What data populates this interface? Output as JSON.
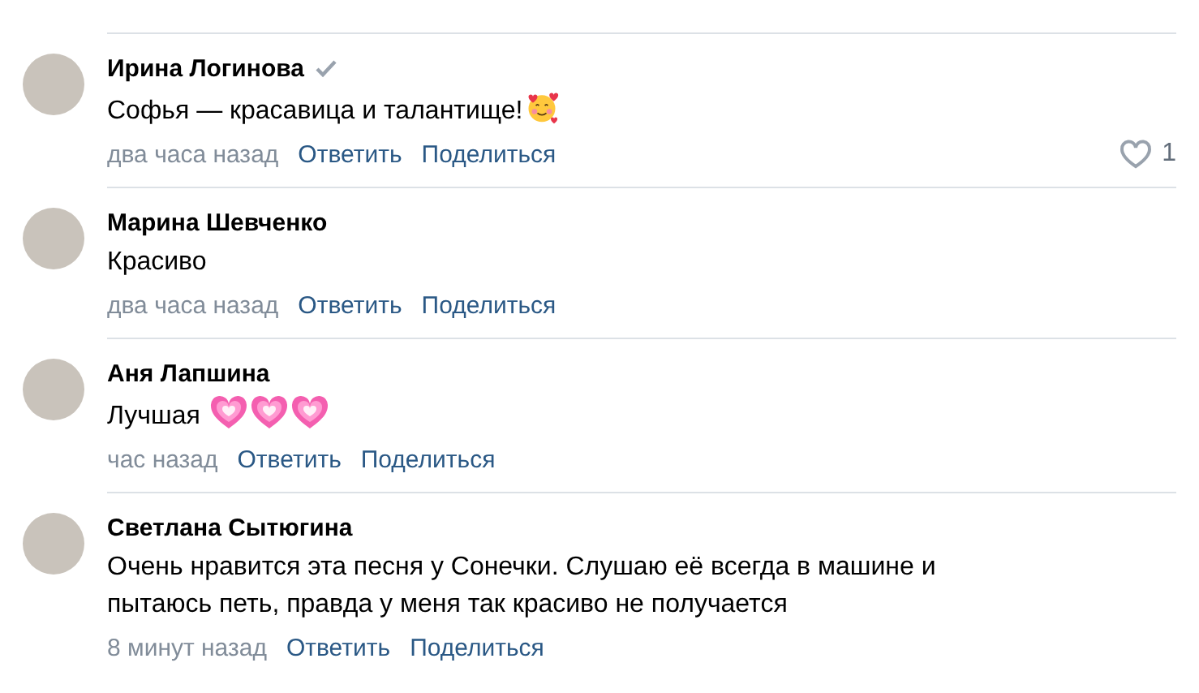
{
  "comments": [
    {
      "author": "Ирина Логинова",
      "verified": true,
      "text": "Софья — красавица и талантище!",
      "emojis": [
        {
          "kind": "smiling-hearts"
        }
      ],
      "time": "два часа назад",
      "actions": [
        "Ответить",
        "Поделиться"
      ],
      "likes": "1",
      "liked": false
    },
    {
      "author": "Марина Шевченко",
      "verified": false,
      "text": "Красиво",
      "time": "два часа назад",
      "actions": [
        "Ответить",
        "Поделиться"
      ]
    },
    {
      "author": "Аня Лапшина",
      "verified": false,
      "text": "Лучшая ",
      "emojis": [
        {
          "kind": "pink-heart"
        },
        {
          "kind": "pink-heart"
        },
        {
          "kind": "pink-heart"
        }
      ],
      "time": "час назад",
      "actions": [
        "Ответить",
        "Поделиться"
      ]
    },
    {
      "author": "Светлана Сытюгина",
      "verified": false,
      "text": "Очень нравится эта песня у Сонечки. Слушаю её всегда в машине и пытаюсь петь, правда у меня так красиво не получается",
      "time": "8 минут назад",
      "actions": [
        "Ответить",
        "Поделиться"
      ]
    }
  ]
}
